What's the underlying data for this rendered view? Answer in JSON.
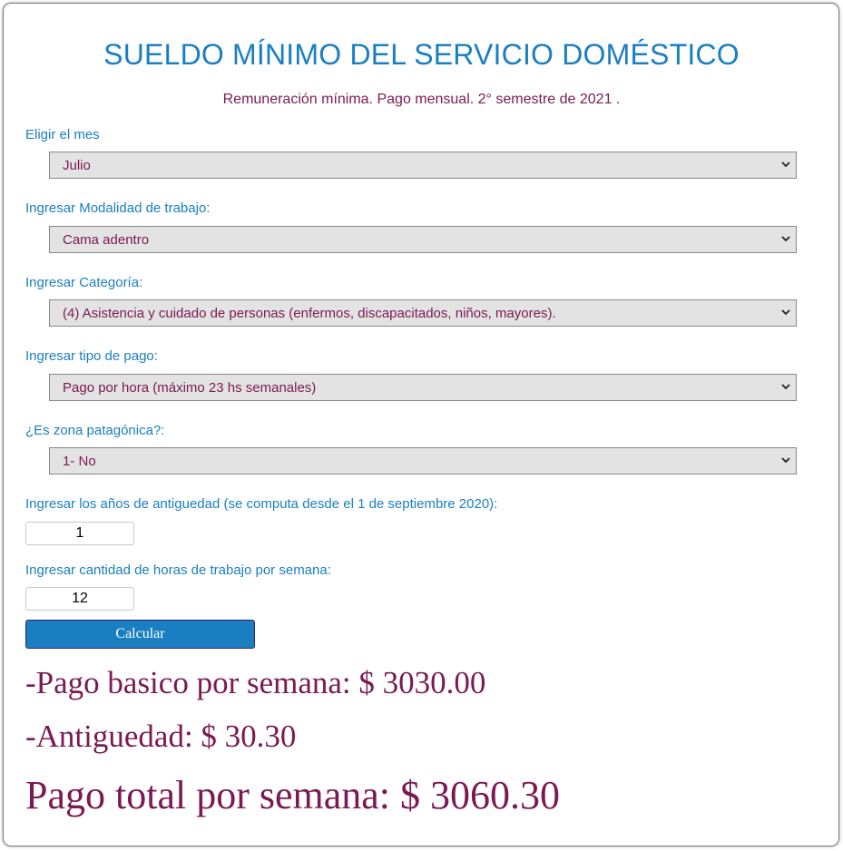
{
  "header": {
    "title": "SUELDO MÍNIMO DEL SERVICIO DOMÉSTICO",
    "subtitle": "Remuneración mínima. Pago mensual. 2° semestre de 2021 ."
  },
  "form": {
    "mes": {
      "label": "Eligir el mes",
      "value": "Julio"
    },
    "modalidad": {
      "label": "Ingresar Modalidad de trabajo:",
      "value": "Cama adentro"
    },
    "categoria": {
      "label": "Ingresar Categoría:",
      "value": "(4) Asistencia y cuidado de personas (enfermos, discapacitados, niños, mayores)."
    },
    "tipo_pago": {
      "label": "Ingresar tipo de pago:",
      "value": "Pago por hora (máximo 23 hs semanales)"
    },
    "zona": {
      "label": "¿Es zona patagónica?:",
      "value": "1- No"
    },
    "antiguedad": {
      "label": "Ingresar los años de antiguedad (se computa desde el 1 de septiembre 2020):",
      "value": "1"
    },
    "horas": {
      "label": "Ingresar cantidad de horas de trabajo por semana:",
      "value": "12"
    },
    "button_label": "Calcular"
  },
  "results": {
    "basico": "-Pago basico por semana: $ 3030.00",
    "antiguedad": "-Antiguedad: $ 30.30",
    "total": "Pago total por semana: $ 3060.30"
  },
  "colors": {
    "accent": "#1a7fc1",
    "result_text": "#7a1a52",
    "select_bg": "#e3e3e3"
  }
}
